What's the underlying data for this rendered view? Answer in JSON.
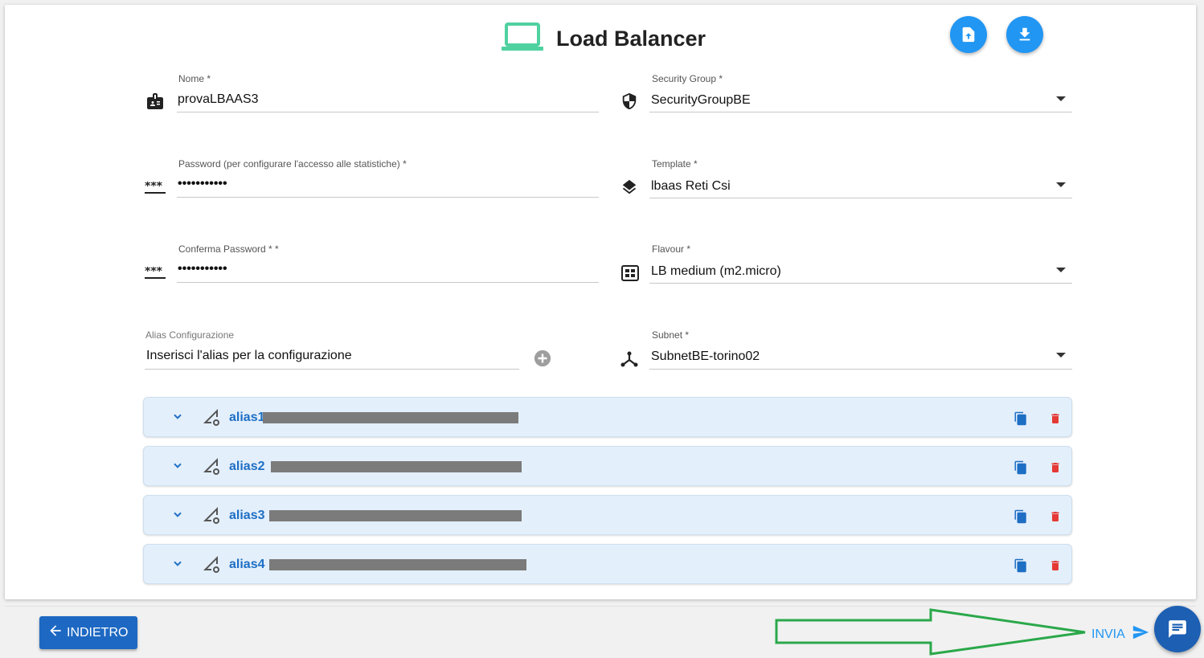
{
  "header": {
    "title": "Load Balancer",
    "title_icon": "laptop-icon",
    "upload_icon": "file-upload-icon",
    "download_icon": "download-icon"
  },
  "form": {
    "nome": {
      "label": "Nome *",
      "value": "provaLBAAS3",
      "icon": "badge-icon"
    },
    "password": {
      "label": "Password (per configurare l'accesso alle statistiche) *",
      "value": "•••••••••••",
      "icon": "password-icon"
    },
    "conferma_password": {
      "label": "Conferma Password * *",
      "value": "•••••••••••",
      "icon": "password-icon"
    },
    "alias_configurazione": {
      "label": "Alias Configurazione",
      "placeholder": "Inserisci l'alias per la configurazione",
      "add_icon": "plus-circle-icon"
    },
    "security_group": {
      "label": "Security Group *",
      "value": "SecurityGroupBE",
      "icon": "shield-icon"
    },
    "template": {
      "label": "Template *",
      "value": "lbaas Reti Csi",
      "icon": "layers-icon"
    },
    "flavour": {
      "label": "Flavour *",
      "value": "LB medium (m2.micro)",
      "icon": "chip-icon"
    },
    "subnet": {
      "label": "Subnet *",
      "value": "SubnetBE-torino02",
      "icon": "hub-icon"
    }
  },
  "aliases": [
    {
      "name": "alias1"
    },
    {
      "name": "alias2"
    },
    {
      "name": "alias3"
    },
    {
      "name": "alias4"
    }
  ],
  "footer": {
    "back_label": "INDIETRO",
    "send_label": "INVIA",
    "chat_icon": "chat-icon"
  },
  "colors": {
    "primary": "#2196f3",
    "dark_primary": "#1d68c2",
    "alias_bg": "#e3effb",
    "alias_text": "#1e6fc4",
    "delete": "#e53935",
    "laptop": "#4fd1a0",
    "annotation_arrow": "#2aa84a"
  }
}
